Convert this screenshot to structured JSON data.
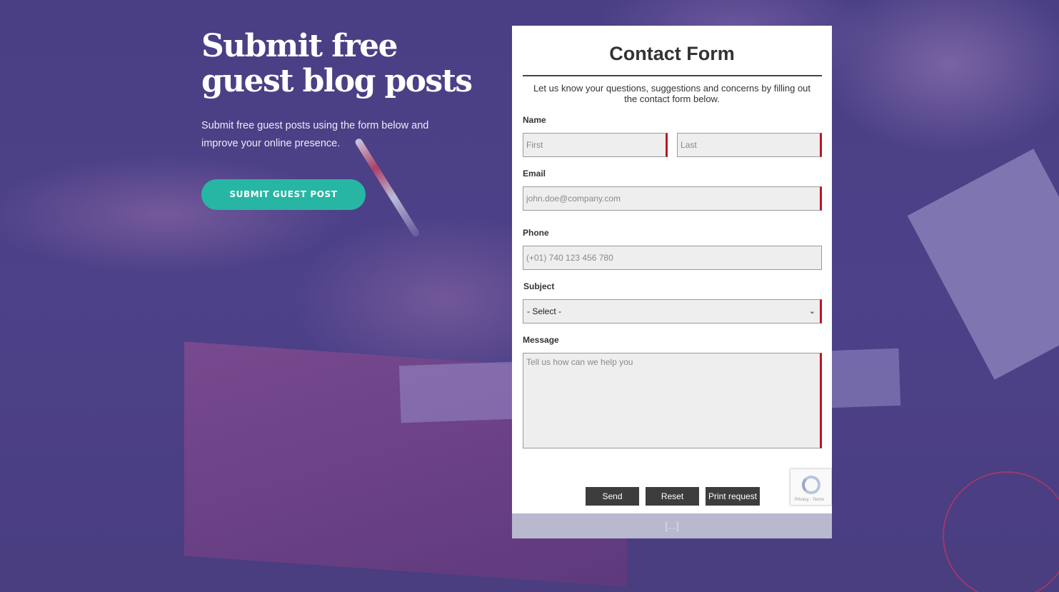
{
  "hero": {
    "title": "Submit free guest blog posts",
    "text": "Submit free guest posts using the form below and improve your online presence.",
    "button_label": "SUBMIT GUEST POST"
  },
  "form": {
    "title": "Contact Form",
    "subtitle": "Let us know your questions, suggestions and concerns by filling out the contact form below.",
    "name_label": "Name",
    "first_placeholder": "First",
    "last_placeholder": "Last",
    "email_label": "Email",
    "email_placeholder": "john.doe@company.com",
    "phone_label": "Phone",
    "phone_placeholder": "(+01) 740 123 456 780",
    "subject_label": "Subject",
    "subject_selected": "- Select -",
    "message_label": "Message",
    "message_placeholder": "Tell us how can we help you",
    "send_label": "Send",
    "reset_label": "Reset",
    "print_label": "Print request",
    "recaptcha_terms": "Privacy - Terms",
    "footer_text": "[...]"
  },
  "colors": {
    "accent_teal": "#27b6a4",
    "required_marker": "#c1121f",
    "button_dark": "#3d3d3d",
    "background_purple": "#4b3f85"
  }
}
